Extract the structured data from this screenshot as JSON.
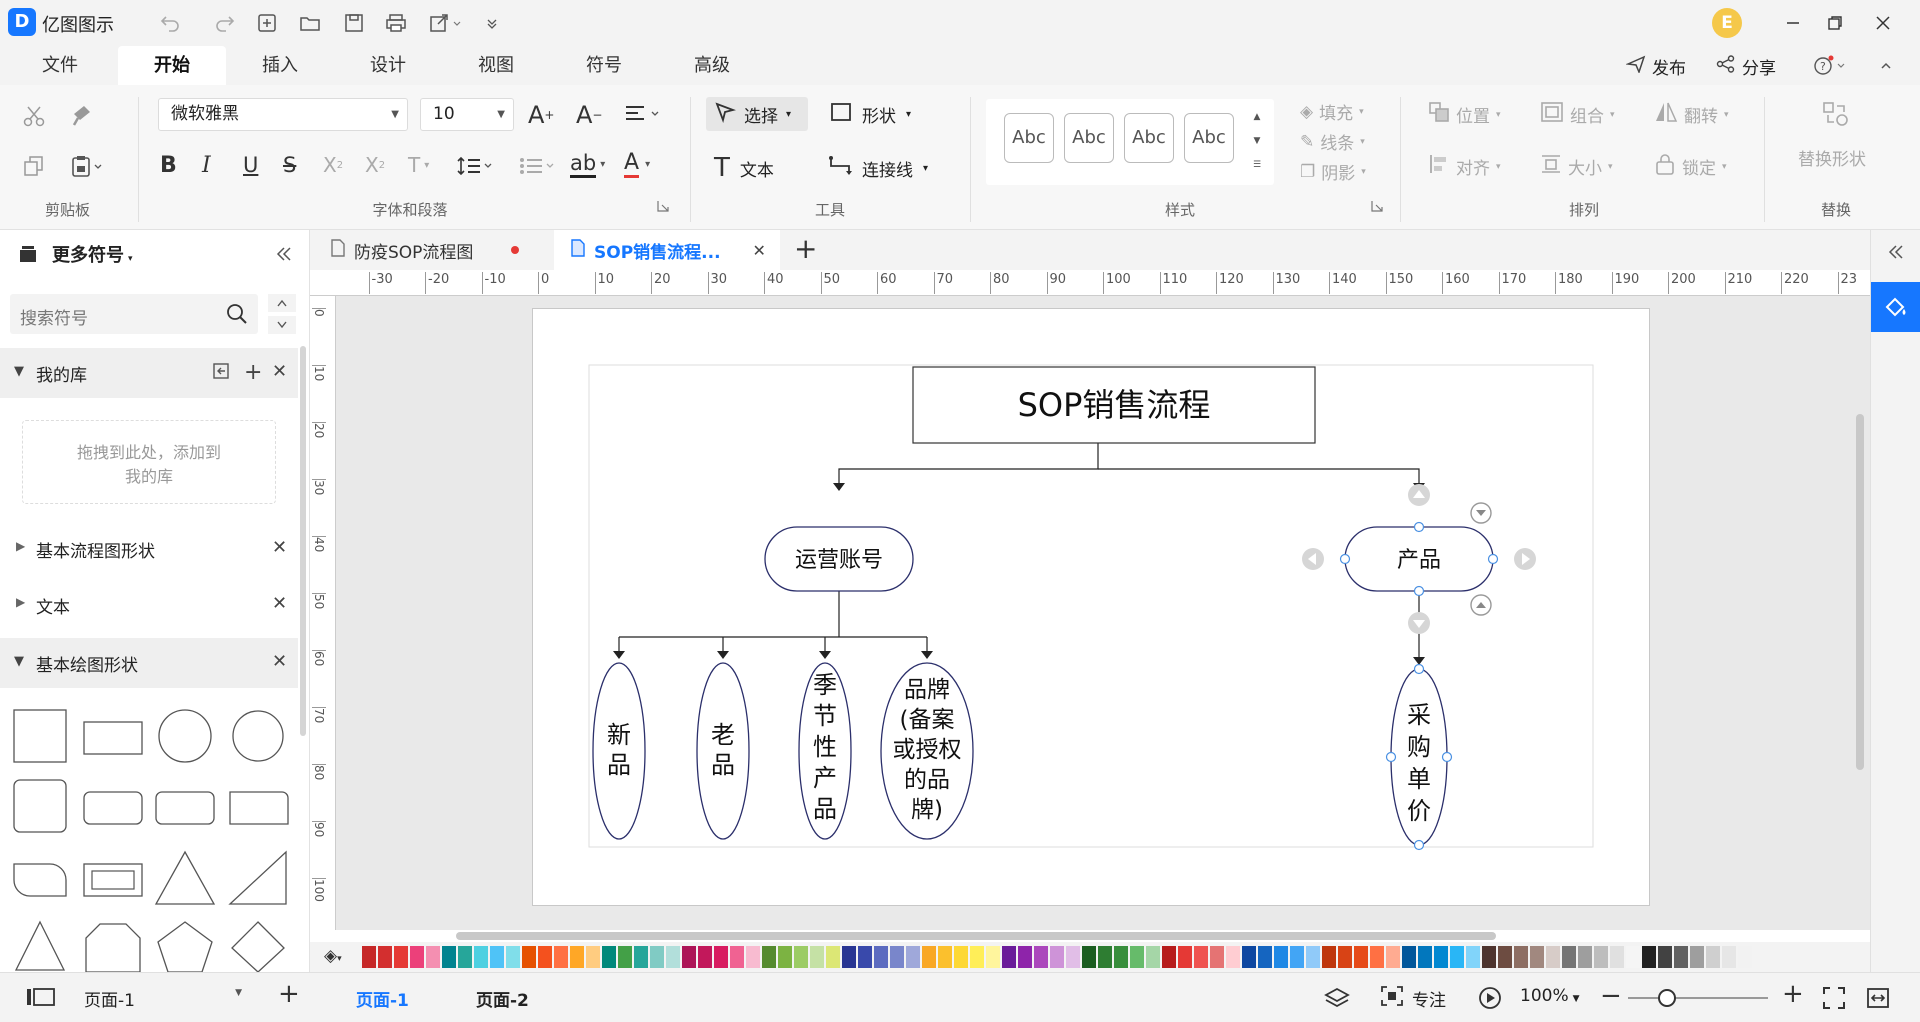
{
  "app": {
    "title": "亿图图示",
    "logo_letter": "D",
    "avatar_letter": "E"
  },
  "menu": {
    "tabs": [
      "文件",
      "开始",
      "插入",
      "设计",
      "视图",
      "符号",
      "高级"
    ],
    "publish": "发布",
    "share": "分享"
  },
  "ribbon": {
    "clipboard_group": "剪贴板",
    "font_group": "字体和段落",
    "font_name": "微软雅黑",
    "font_size": "10",
    "tools_group": "工具",
    "select": "选择",
    "shape": "形状",
    "text": "文本",
    "connector": "连接线",
    "styles_group": "样式",
    "style_samples": [
      "Abc",
      "Abc",
      "Abc",
      "Abc"
    ],
    "fill": "填充",
    "line": "线条",
    "shadow": "阴影",
    "arrange_group": "排列",
    "position": "位置",
    "group": "组合",
    "flip": "翻转",
    "align": "对齐",
    "size": "大小",
    "lock": "锁定",
    "replace_group": "替换",
    "replace_shape": "替换形状"
  },
  "sidebar": {
    "title": "更多符号",
    "search_placeholder": "搜索符号",
    "my_library": "我的库",
    "drop_hint": "拖拽到此处，添加到我的库",
    "sections": [
      "基本流程图形状",
      "文本",
      "基本绘图形状"
    ]
  },
  "tabs": [
    {
      "label": "防疫SOP流程图",
      "active": false,
      "unsaved": true
    },
    {
      "label": "SOP销售流程...",
      "active": true
    }
  ],
  "ruler": {
    "h": [
      "-30",
      "-20",
      "-10",
      "0",
      "10",
      "20",
      "30",
      "40",
      "50",
      "60",
      "70",
      "80",
      "90",
      "100",
      "110",
      "120",
      "130",
      "140",
      "150",
      "160",
      "170",
      "180",
      "190",
      "200",
      "210",
      "220",
      "23"
    ],
    "v": [
      "0",
      "10",
      "20",
      "30",
      "40",
      "50",
      "60",
      "70",
      "80",
      "90",
      "100"
    ]
  },
  "diagram": {
    "root": "SOP销售流程",
    "left": "运营账号",
    "right": "产品",
    "leaves": [
      [
        "新",
        "品"
      ],
      [
        "老",
        "品"
      ],
      [
        "季",
        "节",
        "性",
        "产",
        "品"
      ],
      [
        "品牌",
        "(备案",
        "或授权",
        "的品",
        "牌)"
      ]
    ],
    "right_leaf": [
      "采",
      "购",
      "单",
      "价"
    ]
  },
  "colors": {
    "accent": "#1677ff",
    "palette": [
      "#c62828",
      "#d32f2f",
      "#e53935",
      "#ec407a",
      "#f48fb1",
      "#00838f",
      "#26a69a",
      "#4dd0e1",
      "#4fc3f7",
      "#80deea",
      "#e65100",
      "#f4511e",
      "#ff7043",
      "#ffa726",
      "#ffcc80",
      "#00897b",
      "#43a047",
      "#26a69a",
      "#80cbc4",
      "#b2dfdb",
      "#ad1457",
      "#c2185b",
      "#d81b60",
      "#f06292",
      "#f8bbd0",
      "#558b2f",
      "#7cb342",
      "#9ccc65",
      "#c5e1a5",
      "#dce775",
      "#283593",
      "#3949ab",
      "#5c6bc0",
      "#7986cb",
      "#9fa8da",
      "#f9a825",
      "#fbc02d",
      "#fdd835",
      "#ffee58",
      "#fff59d",
      "#6a1b9a",
      "#8e24aa",
      "#ab47bc",
      "#ce93d8",
      "#e1bee7",
      "#1b5e20",
      "#2e7d32",
      "#388e3c",
      "#66bb6a",
      "#a5d6a7",
      "#b71c1c",
      "#e53935",
      "#ef5350",
      "#e57373",
      "#ffcdd2",
      "#0d47a1",
      "#1565c0",
      "#1e88e5",
      "#42a5f5",
      "#90caf9",
      "#bf360c",
      "#d84315",
      "#e64a19",
      "#ff7043",
      "#ffab91",
      "#01579b",
      "#0277bd",
      "#0288d1",
      "#29b6f6",
      "#81d4fa",
      "#4e342e",
      "#6d4c41",
      "#8d6e63",
      "#a1887f",
      "#d7ccc8",
      "#757575",
      "#9e9e9e",
      "#bdbdbd",
      "#e0e0e0",
      "#f5f5f5",
      "#212121",
      "#424242",
      "#616161",
      "#9e9e9e",
      "#cfcfcf",
      "#e6e6e6",
      "#f2f2f2"
    ]
  },
  "status": {
    "page_selector": "页面-1",
    "pages": [
      "页面-1",
      "页面-2"
    ],
    "focus": "专注",
    "zoom": "100%"
  }
}
